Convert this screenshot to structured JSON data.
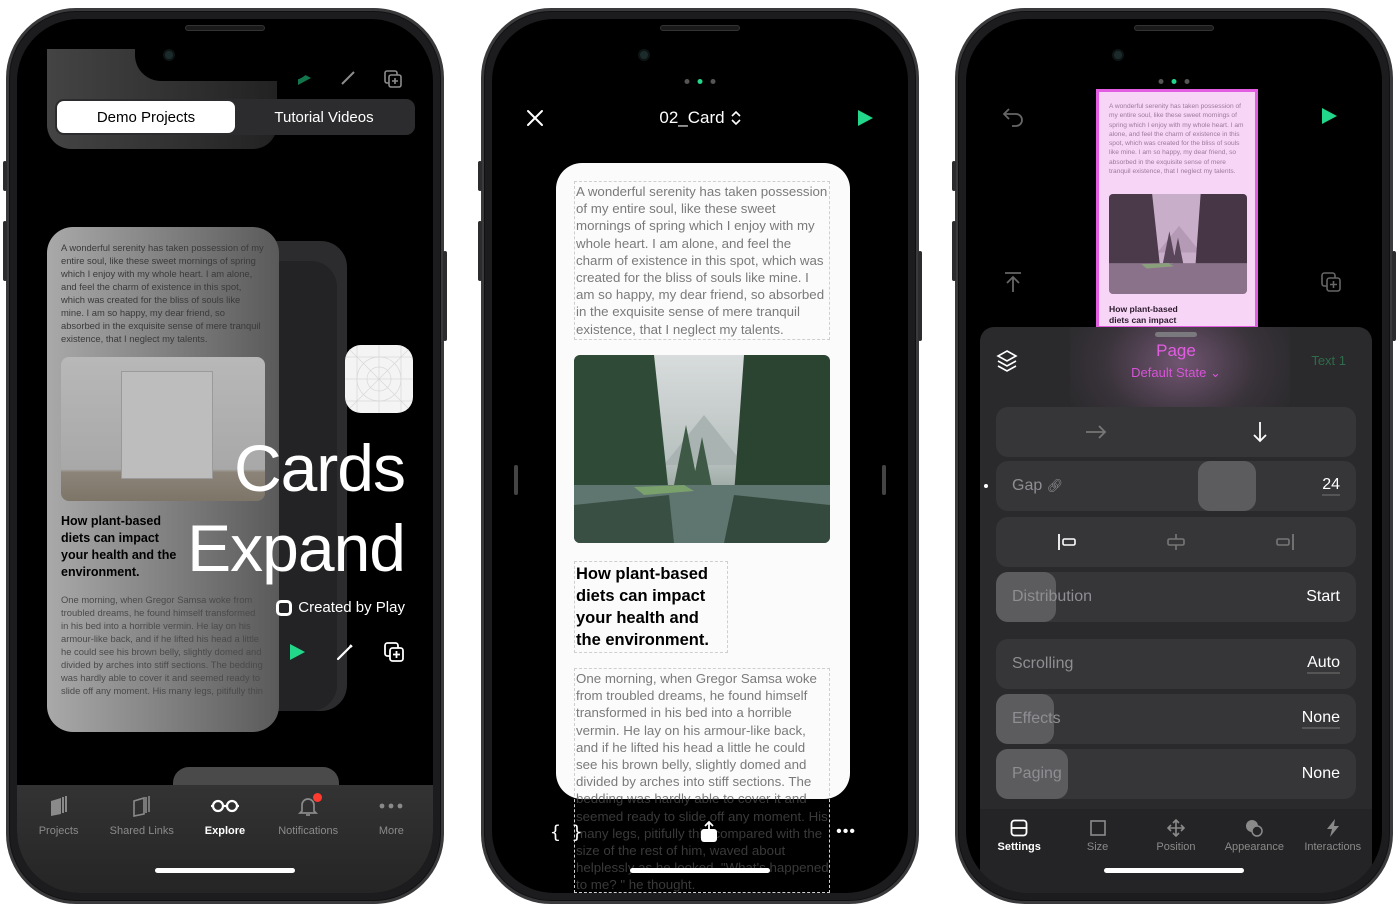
{
  "phones": {
    "explore": {
      "segmented": {
        "items": [
          "Demo Projects",
          "Tutorial Videos"
        ],
        "selected": "Demo Projects"
      },
      "card": {
        "intro_text": "A wonderful serenity has taken possession of my entire soul, like these sweet mornings of spring which I enjoy with my whole heart. I am alone, and feel the charm of existence in this spot, which was created for the bliss of souls like mine. I am so happy, my dear friend, so absorbed in the exquisite sense of mere tranquil existence, that I neglect my talents.",
        "headline": "How plant-based diets can impact your health and the environment.",
        "body_text": "One morning, when Gregor Samsa woke from troubled dreams, he found himself transformed in his bed into a horrible vermin. He lay on his armour-like back, and if he lifted his head a little he could see his brown belly, slightly domed and divided by arches into stiff sections. The bedding was hardly able to cover it and seemed ready to slide off any moment. His many legs, pitifully thin"
      },
      "project": {
        "title_line1": "Cards",
        "title_line2": "Expand",
        "creator": "Created by Play"
      },
      "actions": {
        "play": "play-icon",
        "edit": "pencil-icon",
        "duplicate": "duplicate-icon"
      },
      "tabbar": [
        {
          "label": "Projects",
          "icon": "stack-icon",
          "active": false
        },
        {
          "label": "Shared Links",
          "icon": "shared-stack-icon",
          "active": false
        },
        {
          "label": "Explore",
          "icon": "glasses-icon",
          "active": true
        },
        {
          "label": "Notifications",
          "icon": "bell-icon",
          "active": false,
          "badge": true
        },
        {
          "label": "More",
          "icon": "more-icon",
          "active": false
        }
      ]
    },
    "editor": {
      "page_dots": {
        "count": 3,
        "active_index": 1
      },
      "title": "02_Card",
      "text_block_1": "A wonderful serenity has taken possession of my entire soul, like these sweet mornings of spring which I enjoy with my whole heart. I am alone, and feel the charm of existence in this spot, which was created for the bliss of souls like mine. I am so happy, my dear friend, so absorbed in the exquisite sense of mere tranquil existence, that I neglect my talents.",
      "headline": "How plant-based diets can impact your health and the environment.",
      "text_block_2": "One morning, when Gregor Samsa woke from troubled dreams, he found himself transformed in his bed into a horrible vermin. He lay on his armour-like back, and if he lifted his head a little he could see his brown belly, slightly domed and divided by arches into stiff sections. The bedding was hardly able to cover it and seemed ready to slide off any moment. His many legs, pitifully thin compared with the size of the rest of him, waved about helplessly as he looked. \"What's happened to me? \" he thought.",
      "bottom": {
        "code_label": "{ }",
        "more_label": "•••"
      }
    },
    "inspector": {
      "page_dots": {
        "count": 3,
        "active_index": 1
      },
      "preview": {
        "text": "A wonderful serenity has taken possession of my entire soul, like these sweet mornings of spring which I enjoy with my whole heart. I am alone, and feel the charm of existence in this spot, which was created for the bliss of souls like mine. I am so happy, my dear friend, so absorbed in the exquisite sense of mere tranquil existence, that I neglect my talents.",
        "headline": "How plant-based diets can impact"
      },
      "panel": {
        "title": "Page",
        "state": "Default State",
        "next_layer": "Text 1",
        "direction": {
          "options": [
            "horizontal",
            "vertical"
          ],
          "selected": "vertical"
        },
        "gap": {
          "label": "Gap",
          "value": "24"
        },
        "alignment": {
          "options": [
            "start",
            "center",
            "end"
          ],
          "selected": "start"
        },
        "rows": [
          {
            "label": "Distribution",
            "value": "Start"
          },
          {
            "label": "Scrolling",
            "value": "Auto"
          },
          {
            "label": "Effects",
            "value": "None"
          },
          {
            "label": "Paging",
            "value": "None"
          }
        ]
      },
      "tabs": [
        {
          "label": "Settings",
          "icon": "settings-icon",
          "active": true
        },
        {
          "label": "Size",
          "icon": "size-icon",
          "active": false
        },
        {
          "label": "Position",
          "icon": "position-icon",
          "active": false
        },
        {
          "label": "Appearance",
          "icon": "appearance-icon",
          "active": false
        },
        {
          "label": "Interactions",
          "icon": "lightning-icon",
          "active": false
        }
      ]
    }
  },
  "colors": {
    "accent_green": "#22d68a",
    "accent_pink": "#e35de3",
    "badge_red": "#ff3b30"
  }
}
